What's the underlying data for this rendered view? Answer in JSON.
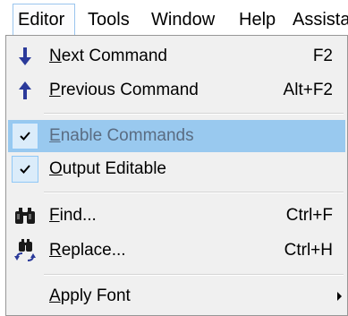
{
  "menubar": {
    "items": [
      {
        "label": "Editor",
        "underline_index": 1
      },
      {
        "label": "Tools",
        "underline_index": 0
      },
      {
        "label": "Window",
        "underline_index": 0
      },
      {
        "label": "Help",
        "underline_index": 0
      },
      {
        "label": "Assista",
        "underline_index": -1
      }
    ],
    "active": "Editor"
  },
  "menu": {
    "items": [
      {
        "label": "Next Command",
        "mnemonic_index": 0,
        "shortcut": "F2",
        "icon": "arrow-down-icon"
      },
      {
        "label": "Previous Command",
        "mnemonic_index": 0,
        "shortcut": "Alt+F2",
        "icon": "arrow-up-icon"
      },
      {
        "label": "Enable Commands",
        "mnemonic_index": 0,
        "checked": true,
        "highlighted": true,
        "icon": "checkmark-icon"
      },
      {
        "label": "Output Editable",
        "mnemonic_index": 0,
        "checked": true,
        "icon": "checkmark-icon"
      },
      {
        "label": "Find...",
        "mnemonic_index": 0,
        "shortcut": "Ctrl+F",
        "icon": "binoculars-icon"
      },
      {
        "label": "Replace...",
        "mnemonic_index": 0,
        "shortcut": "Ctrl+H",
        "icon": "replace-icon"
      },
      {
        "label": "Apply Font",
        "mnemonic_index": 0,
        "submenu": true,
        "icon": "chevron-right-icon"
      }
    ]
  },
  "colors": {
    "menu_bg": "#f0f0f0",
    "highlight": "#99c9ef",
    "icon_blue": "#2b3a9a",
    "check_bg": "#dbecfa"
  }
}
